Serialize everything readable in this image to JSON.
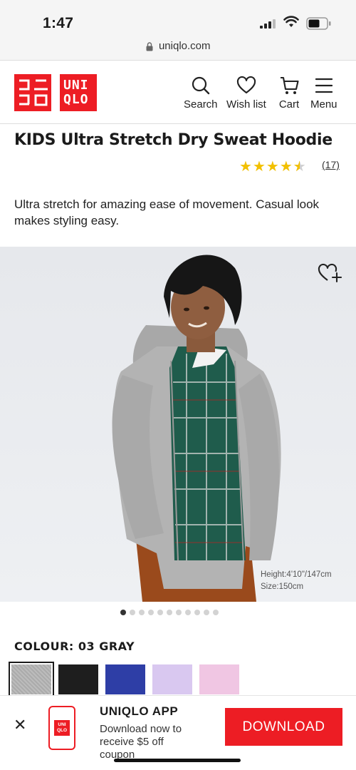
{
  "status_bar": {
    "time": "1:47"
  },
  "browser": {
    "url": "uniqlo.com"
  },
  "header": {
    "logo_kata": "ユニクロ",
    "logo_latin_line1": "UNI",
    "logo_latin_line2": "QLO",
    "nav": [
      {
        "label": "Search",
        "icon": "search-icon"
      },
      {
        "label": "Wish list",
        "icon": "heart-icon"
      },
      {
        "label": "Cart",
        "icon": "cart-icon"
      },
      {
        "label": "Menu",
        "icon": "menu-icon"
      }
    ]
  },
  "product": {
    "title": "KIDS Ultra Stretch Dry Sweat Hoodie",
    "rating": 4.5,
    "reviews_label": "(17)",
    "description": "Ultra stretch for amazing ease of movement. Casual look makes styling easy.",
    "model_height": "Height:4'10\"/147cm",
    "model_size": "Size:150cm",
    "image_count": 11,
    "active_image": 0,
    "colour_label": "COLOUR: 03 GRAY",
    "swatches": [
      {
        "name": "gray",
        "color": "#b2b2b2",
        "selected": true
      },
      {
        "name": "black",
        "color": "#1e1e1e",
        "selected": false
      },
      {
        "name": "blue",
        "color": "#2e3ea6",
        "selected": false
      },
      {
        "name": "lavender",
        "color": "#d9c8f0",
        "selected": false
      },
      {
        "name": "pink",
        "color": "#f0c6e3",
        "selected": false
      }
    ]
  },
  "app_banner": {
    "close_icon": "close-icon",
    "title": "UNIQLO APP",
    "subtitle": "Download now to receive $5 off coupon",
    "icon_text_line1": "UNI",
    "icon_text_line2": "QLO",
    "button_label": "DOWNLOAD"
  },
  "colors": {
    "brand_red": "#ed1d24",
    "star": "#f2c000"
  }
}
